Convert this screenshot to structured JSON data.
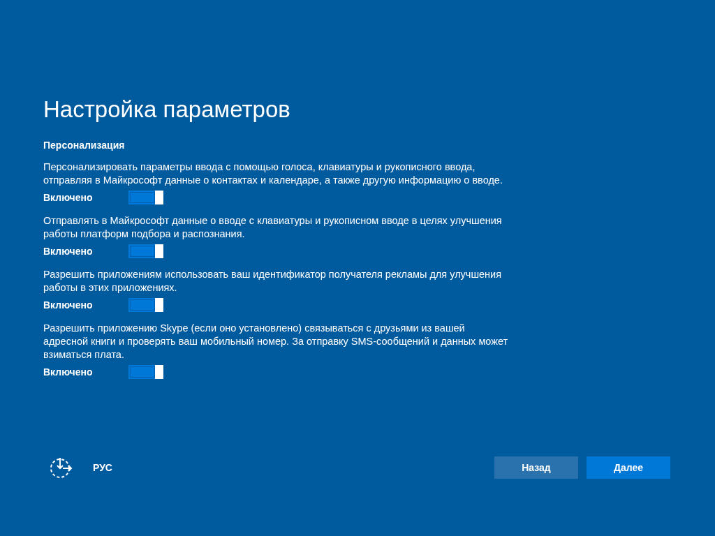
{
  "title": "Настройка параметров",
  "section": "Персонализация",
  "settings": [
    {
      "description": "Персонализировать параметры ввода с помощью голоса, клавиатуры и рукописного ввода, отправляя в Майкрософт данные о контактах и календаре, а также другую информацию о вводе.",
      "state_label": "Включено",
      "on": true
    },
    {
      "description": "Отправлять в Майкрософт данные о вводе с клавиатуры и рукописном вводе в целях улучшения работы платформ подбора и распознания.",
      "state_label": "Включено",
      "on": true
    },
    {
      "description": "Разрешить приложениям использовать ваш идентификатор получателя рекламы для улучшения работы в этих приложениях.",
      "state_label": "Включено",
      "on": true
    },
    {
      "description": "Разрешить приложению Skype (если оно установлено) связываться с друзьями из вашей адресной книги и проверять ваш мобильный номер. За отправку SMS-сообщений и данных может взиматься плата.",
      "state_label": "Включено",
      "on": true
    }
  ],
  "footer": {
    "language": "РУС",
    "buttons": [
      {
        "label": "Назад",
        "kind": "secondary"
      },
      {
        "label": "Далее",
        "kind": "primary"
      }
    ]
  }
}
